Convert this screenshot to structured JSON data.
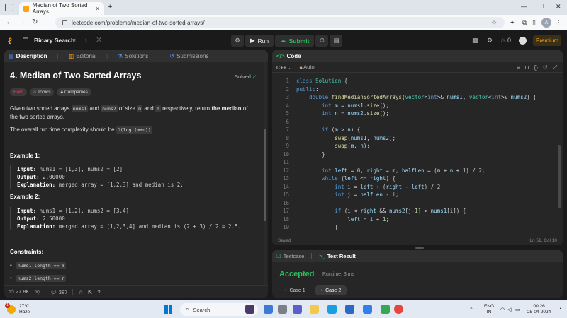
{
  "browser": {
    "tab_title": "Median of Two Sorted Arrays",
    "url": "leetcode.com/problems/median-of-two-sorted-arrays/"
  },
  "nav": {
    "problem_list": "Binary Search",
    "run": "Run",
    "submit": "Submit",
    "streak": "0",
    "premium": "Premium"
  },
  "left_tabs": [
    "Description",
    "Editorial",
    "Solutions",
    "Submissions"
  ],
  "problem": {
    "title": "4. Median of Two Sorted Arrays",
    "solved": "Solved",
    "tags": [
      "Hard",
      "Topics",
      "Companies"
    ],
    "desc_1a": "Given two sorted arrays ",
    "desc_1_code1": "nums1",
    "desc_1b": " and ",
    "desc_1_code2": "nums2",
    "desc_1c": " of size ",
    "desc_1_code3": "m",
    "desc_1d": " and ",
    "desc_1_code4": "n",
    "desc_1e": " respectively, return ",
    "desc_1_bold": "the median",
    "desc_1f": " of the two sorted arrays.",
    "desc_2a": "The overall run time complexity should be ",
    "desc_2_code": "O(log (m+n))",
    "desc_2b": ".",
    "example1_title": "Example 1:",
    "example1": {
      "input_label": "Input:",
      "input": " nums1 = [1,3], nums2 = [2]",
      "output_label": "Output:",
      "output": " 2.00000",
      "expl_label": "Explanation:",
      "expl": " merged array = [1,2,3] and median is 2."
    },
    "example2_title": "Example 2:",
    "example2": {
      "input_label": "Input:",
      "input": " nums1 = [1,2], nums2 = [3,4]",
      "output_label": "Output:",
      "output": " 2.50000",
      "expl_label": "Explanation:",
      "expl": " merged array = [1,2,3,4] and median is (2 + 3) / 2 = 2.5."
    },
    "constraints_title": "Constraints:",
    "constraints": [
      "nums1.length == m",
      "nums2.length == n"
    ],
    "likes": "27.8K",
    "comments": "387"
  },
  "code_panel": {
    "title": "Code",
    "language": "C++",
    "mode": "Auto",
    "saved": "Saved",
    "cursor": "Ln 51, Col 10"
  },
  "code_lines": [
    [
      [
        "k",
        "class "
      ],
      [
        "t",
        "Solution"
      ],
      [
        "p",
        " {"
      ]
    ],
    [
      [
        "k",
        "public"
      ],
      [
        "p",
        ":"
      ]
    ],
    [
      [
        "p",
        "    "
      ],
      [
        "k",
        "double "
      ],
      [
        "f",
        "findMedianSortedArrays"
      ],
      [
        "p",
        "("
      ],
      [
        "t",
        "vector"
      ],
      [
        "p",
        "<"
      ],
      [
        "k",
        "int"
      ],
      [
        "p",
        ">& "
      ],
      [
        "v",
        "nums1"
      ],
      [
        "p",
        ", "
      ],
      [
        "t",
        "vector"
      ],
      [
        "p",
        "<"
      ],
      [
        "k",
        "int"
      ],
      [
        "p",
        ">& "
      ],
      [
        "v",
        "nums2"
      ],
      [
        "p",
        ") {"
      ]
    ],
    [
      [
        "p",
        "        "
      ],
      [
        "k",
        "int "
      ],
      [
        "v",
        "m"
      ],
      [
        "p",
        " = "
      ],
      [
        "v",
        "nums1"
      ],
      [
        "p",
        "."
      ],
      [
        "f",
        "size"
      ],
      [
        "p",
        "();"
      ]
    ],
    [
      [
        "p",
        "        "
      ],
      [
        "k",
        "int "
      ],
      [
        "v",
        "n"
      ],
      [
        "p",
        " = "
      ],
      [
        "v",
        "nums2"
      ],
      [
        "p",
        "."
      ],
      [
        "f",
        "size"
      ],
      [
        "p",
        "();"
      ]
    ],
    [],
    [
      [
        "p",
        "        "
      ],
      [
        "k",
        "if "
      ],
      [
        "p",
        "("
      ],
      [
        "v",
        "m"
      ],
      [
        "p",
        " > "
      ],
      [
        "v",
        "n"
      ],
      [
        "p",
        ") {"
      ]
    ],
    [
      [
        "p",
        "            "
      ],
      [
        "f",
        "swap"
      ],
      [
        "p",
        "("
      ],
      [
        "v",
        "nums1"
      ],
      [
        "p",
        ", "
      ],
      [
        "v",
        "nums2"
      ],
      [
        "p",
        ");"
      ]
    ],
    [
      [
        "p",
        "            "
      ],
      [
        "f",
        "swap"
      ],
      [
        "p",
        "("
      ],
      [
        "v",
        "m"
      ],
      [
        "p",
        ", "
      ],
      [
        "v",
        "n"
      ],
      [
        "p",
        ");"
      ]
    ],
    [
      [
        "p",
        "        }"
      ]
    ],
    [],
    [
      [
        "p",
        "        "
      ],
      [
        "k",
        "int "
      ],
      [
        "v",
        "left"
      ],
      [
        "p",
        " = "
      ],
      [
        "n",
        "0"
      ],
      [
        "p",
        ", "
      ],
      [
        "v",
        "right"
      ],
      [
        "p",
        " = "
      ],
      [
        "v",
        "m"
      ],
      [
        "p",
        ", "
      ],
      [
        "v",
        "halfLen"
      ],
      [
        "p",
        " = ("
      ],
      [
        "v",
        "m"
      ],
      [
        "p",
        " + "
      ],
      [
        "v",
        "n"
      ],
      [
        "p",
        " + "
      ],
      [
        "n",
        "1"
      ],
      [
        "p",
        ") / "
      ],
      [
        "n",
        "2"
      ],
      [
        "p",
        ";"
      ]
    ],
    [
      [
        "p",
        "        "
      ],
      [
        "k",
        "while "
      ],
      [
        "p",
        "("
      ],
      [
        "v",
        "left"
      ],
      [
        "p",
        " <= "
      ],
      [
        "v",
        "right"
      ],
      [
        "p",
        ") {"
      ]
    ],
    [
      [
        "p",
        "            "
      ],
      [
        "k",
        "int "
      ],
      [
        "v",
        "i"
      ],
      [
        "p",
        " = "
      ],
      [
        "v",
        "left"
      ],
      [
        "p",
        " + ("
      ],
      [
        "v",
        "right"
      ],
      [
        "p",
        " - "
      ],
      [
        "v",
        "left"
      ],
      [
        "p",
        ") / "
      ],
      [
        "n",
        "2"
      ],
      [
        "p",
        ";"
      ]
    ],
    [
      [
        "p",
        "            "
      ],
      [
        "k",
        "int "
      ],
      [
        "v",
        "j"
      ],
      [
        "p",
        " = "
      ],
      [
        "v",
        "halfLen"
      ],
      [
        "p",
        " - "
      ],
      [
        "v",
        "i"
      ],
      [
        "p",
        ";"
      ]
    ],
    [],
    [
      [
        "p",
        "            "
      ],
      [
        "k",
        "if "
      ],
      [
        "p",
        "("
      ],
      [
        "v",
        "i"
      ],
      [
        "p",
        " < "
      ],
      [
        "v",
        "right"
      ],
      [
        "p",
        " && "
      ],
      [
        "v",
        "nums2"
      ],
      [
        "p",
        "["
      ],
      [
        "v",
        "j"
      ],
      [
        "p",
        "-"
      ],
      [
        "n",
        "1"
      ],
      [
        "p",
        "] > "
      ],
      [
        "v",
        "nums1"
      ],
      [
        "p",
        "["
      ],
      [
        "v",
        "i"
      ],
      [
        "p",
        "]) {"
      ]
    ],
    [
      [
        "p",
        "                "
      ],
      [
        "v",
        "left"
      ],
      [
        "p",
        " = "
      ],
      [
        "v",
        "i"
      ],
      [
        "p",
        " + "
      ],
      [
        "n",
        "1"
      ],
      [
        "p",
        ";"
      ]
    ],
    [
      [
        "p",
        "            }"
      ]
    ]
  ],
  "bottom_panel": {
    "tab_testcase": "Testcase",
    "tab_result": "Test Result",
    "status": "Accepted",
    "runtime": "Runtime: 3 ms",
    "cases": [
      "Case 1",
      "Case 2"
    ]
  },
  "taskbar": {
    "temp": "27°C",
    "weather": "Haze",
    "weather_badge": "1",
    "search": "Search",
    "lang_1": "ENG",
    "lang_2": "IN",
    "time": "00:26",
    "date": "25-04-2024"
  },
  "colors": {
    "accent": "#ffa116",
    "success": "#2cbb5d",
    "hard": "#ff375f"
  }
}
